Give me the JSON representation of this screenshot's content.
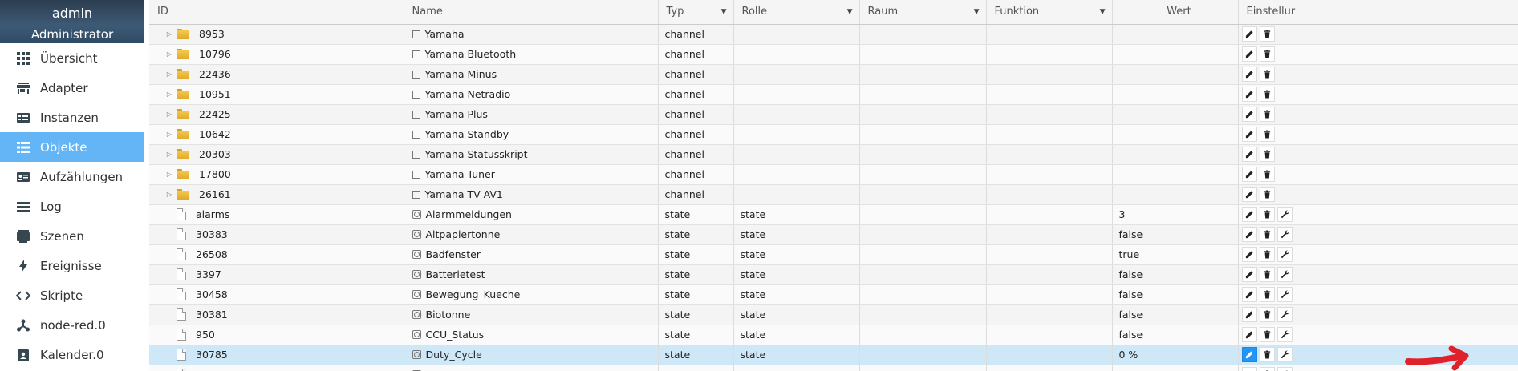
{
  "user": {
    "name": "admin",
    "role": "Administrator"
  },
  "sidebar": {
    "items": [
      {
        "label": "Übersicht",
        "icon": "grid-icon",
        "active": false
      },
      {
        "label": "Adapter",
        "icon": "store-icon",
        "active": false
      },
      {
        "label": "Instanzen",
        "icon": "instances-icon",
        "active": false
      },
      {
        "label": "Objekte",
        "icon": "list-icon",
        "active": true
      },
      {
        "label": "Aufzählungen",
        "icon": "enum-card-icon",
        "active": false
      },
      {
        "label": "Log",
        "icon": "log-lines-icon",
        "active": false
      },
      {
        "label": "Szenen",
        "icon": "scenes-icon",
        "active": false
      },
      {
        "label": "Ereignisse",
        "icon": "lightning-icon",
        "active": false
      },
      {
        "label": "Skripte",
        "icon": "code-icon",
        "active": false
      },
      {
        "label": "node-red.0",
        "icon": "node-red-icon",
        "active": false
      },
      {
        "label": "Kalender.0",
        "icon": "calendar-icon",
        "active": false
      }
    ]
  },
  "table": {
    "headers": {
      "id": "ID",
      "name": "Name",
      "typ": "Typ",
      "rolle": "Rolle",
      "raum": "Raum",
      "funktion": "Funktion",
      "wert": "Wert",
      "einstellungen": "Einstellur"
    },
    "rows": [
      {
        "id": "8953",
        "name": "Yamaha",
        "typ": "channel",
        "rolle": "",
        "wert": "",
        "kind": "folder",
        "selected": false
      },
      {
        "id": "10796",
        "name": "Yamaha Bluetooth",
        "typ": "channel",
        "rolle": "",
        "wert": "",
        "kind": "folder",
        "selected": false
      },
      {
        "id": "22436",
        "name": "Yamaha Minus",
        "typ": "channel",
        "rolle": "",
        "wert": "",
        "kind": "folder",
        "selected": false
      },
      {
        "id": "10951",
        "name": "Yamaha Netradio",
        "typ": "channel",
        "rolle": "",
        "wert": "",
        "kind": "folder",
        "selected": false
      },
      {
        "id": "22425",
        "name": "Yamaha Plus",
        "typ": "channel",
        "rolle": "",
        "wert": "",
        "kind": "folder",
        "selected": false
      },
      {
        "id": "10642",
        "name": "Yamaha Standby",
        "typ": "channel",
        "rolle": "",
        "wert": "",
        "kind": "folder",
        "selected": false
      },
      {
        "id": "20303",
        "name": "Yamaha Statusskript",
        "typ": "channel",
        "rolle": "",
        "wert": "",
        "kind": "folder",
        "selected": false
      },
      {
        "id": "17800",
        "name": "Yamaha Tuner",
        "typ": "channel",
        "rolle": "",
        "wert": "",
        "kind": "folder",
        "selected": false
      },
      {
        "id": "26161",
        "name": "Yamaha TV AV1",
        "typ": "channel",
        "rolle": "",
        "wert": "",
        "kind": "folder",
        "selected": false
      },
      {
        "id": "alarms",
        "name": "Alarmmeldungen",
        "typ": "state",
        "rolle": "state",
        "wert": "3",
        "kind": "file",
        "selected": false
      },
      {
        "id": "30383",
        "name": "Altpapiertonne",
        "typ": "state",
        "rolle": "state",
        "wert": "false",
        "kind": "file",
        "selected": false
      },
      {
        "id": "26508",
        "name": "Badfenster",
        "typ": "state",
        "rolle": "state",
        "wert": "true",
        "kind": "file",
        "selected": false
      },
      {
        "id": "3397",
        "name": "Batterietest",
        "typ": "state",
        "rolle": "state",
        "wert": "false",
        "kind": "file",
        "selected": false
      },
      {
        "id": "30458",
        "name": "Bewegung_Kueche",
        "typ": "state",
        "rolle": "state",
        "wert": "false",
        "kind": "file",
        "selected": false
      },
      {
        "id": "30381",
        "name": "Biotonne",
        "typ": "state",
        "rolle": "state",
        "wert": "false",
        "kind": "file",
        "selected": false
      },
      {
        "id": "950",
        "name": "CCU_Status",
        "typ": "state",
        "rolle": "state",
        "wert": "false",
        "kind": "file",
        "selected": false
      },
      {
        "id": "30785",
        "name": "Duty_Cycle",
        "typ": "state",
        "rolle": "state",
        "wert": "0 %",
        "kind": "file",
        "selected": true
      },
      {
        "id": "",
        "name": "",
        "typ": "",
        "rolle": "",
        "wert": "",
        "kind": "file",
        "selected": false
      }
    ]
  },
  "colors": {
    "active_nav": "#64b5f6",
    "selected_row": "#cfe8f7",
    "edit_active": "#2196f3",
    "annotation_arrow": "#e0202a"
  }
}
